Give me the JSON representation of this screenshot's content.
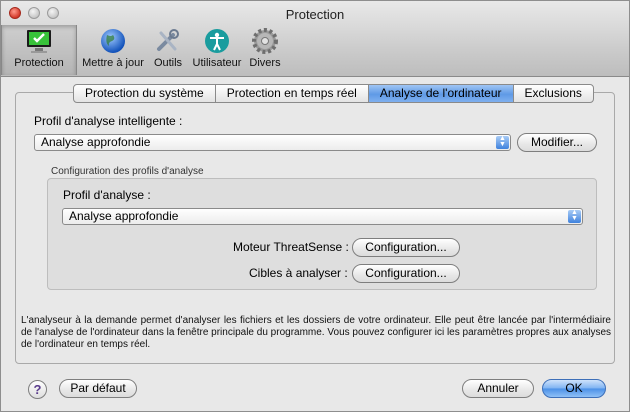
{
  "window": {
    "title": "Protection"
  },
  "toolbar": {
    "items": [
      {
        "label": "Protection",
        "icon": "monitor-check-icon"
      },
      {
        "label": "Mettre à jour",
        "icon": "globe-icon"
      },
      {
        "label": "Outils",
        "icon": "tools-icon"
      },
      {
        "label": "Utilisateur",
        "icon": "accessibility-icon"
      },
      {
        "label": "Divers",
        "icon": "gear-icon"
      }
    ]
  },
  "tabs": [
    "Protection du système",
    "Protection en temps réel",
    "Analyse de l'ordinateur",
    "Exclusions"
  ],
  "smart_profile": {
    "label": "Profil d'analyse intelligente :",
    "value": "Analyse approfondie",
    "modify_button": "Modifier..."
  },
  "profiles_config": {
    "group_label": "Configuration des profils d'analyse",
    "profile_label": "Profil d'analyse :",
    "profile_value": "Analyse approfondie",
    "engine_label": "Moteur ThreatSense :",
    "engine_button": "Configuration...",
    "targets_label": "Cibles à analyser :",
    "targets_button": "Configuration..."
  },
  "description": "L'analyseur à la demande permet d'analyser les fichiers et les dossiers de votre ordinateur. Elle peut être lancée par l'intermédiaire de l'analyse de l'ordinateur dans la fenêtre principale du programme. Vous pouvez configurer ici les paramètres propres aux analyses de l'ordinateur en temps réel.",
  "footer": {
    "help": "?",
    "default_button": "Par défaut",
    "cancel_button": "Annuler",
    "ok_button": "OK"
  }
}
